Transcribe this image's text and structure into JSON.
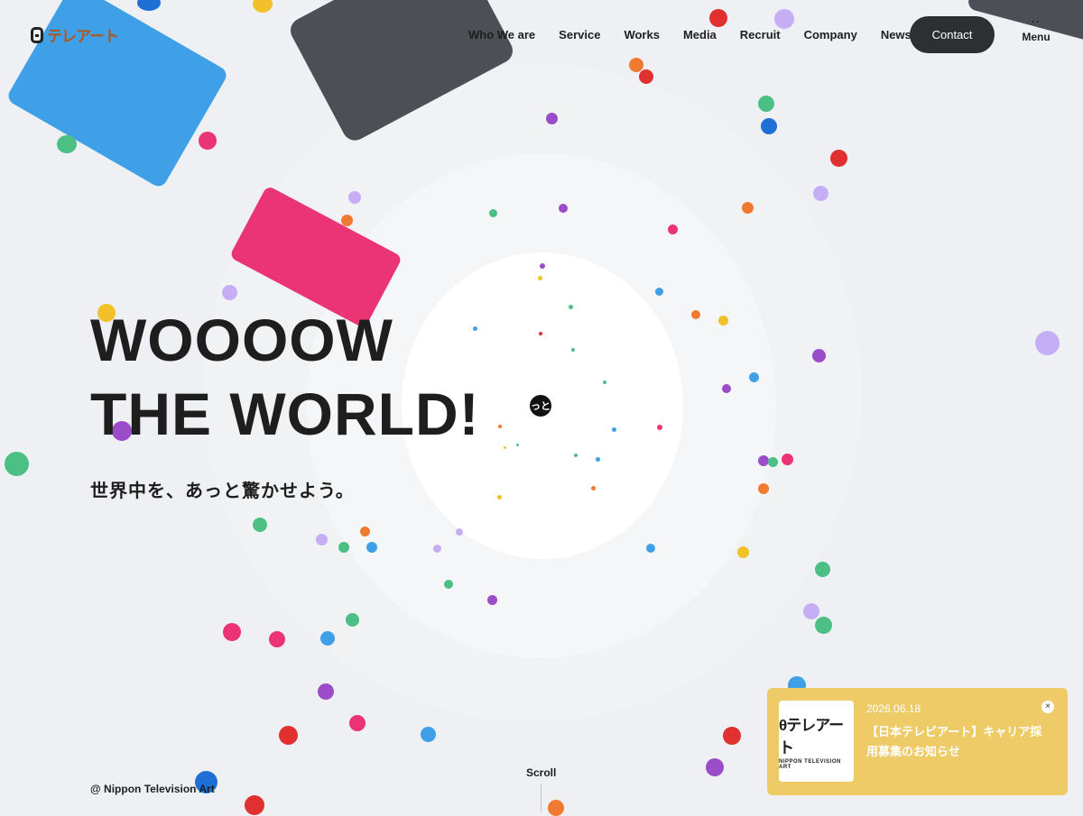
{
  "header": {
    "logo_text": "テレアート",
    "nav": [
      "Who We are",
      "Service",
      "Works",
      "Media",
      "Recruit",
      "Company",
      "News"
    ],
    "contact_label": "Contact",
    "menu_label": "Menu"
  },
  "hero": {
    "title_line1": "WOOOOW",
    "title_line2": "THE WORLD!",
    "subtitle": "世界中を、あっと驚かせよう。",
    "center_badge": "っと"
  },
  "footer": {
    "copyright": "@ Nippon Television Art",
    "scroll_label": "Scroll"
  },
  "popup": {
    "date": "2026.06.18",
    "title": "【日本テレビアート】キャリア採用募集のお知らせ",
    "thumb_logo": "テレアート",
    "thumb_sub": "NIPPON TELEVISION ART",
    "close_icon": "close-icon"
  },
  "colors": {
    "background": "#eef0f3",
    "blue": "#3fa0e8",
    "dark": "#4c4f55",
    "pink": "#ea3474",
    "popup": "#eecb67",
    "button": "#2e2f31",
    "logo": "#b0561f"
  }
}
